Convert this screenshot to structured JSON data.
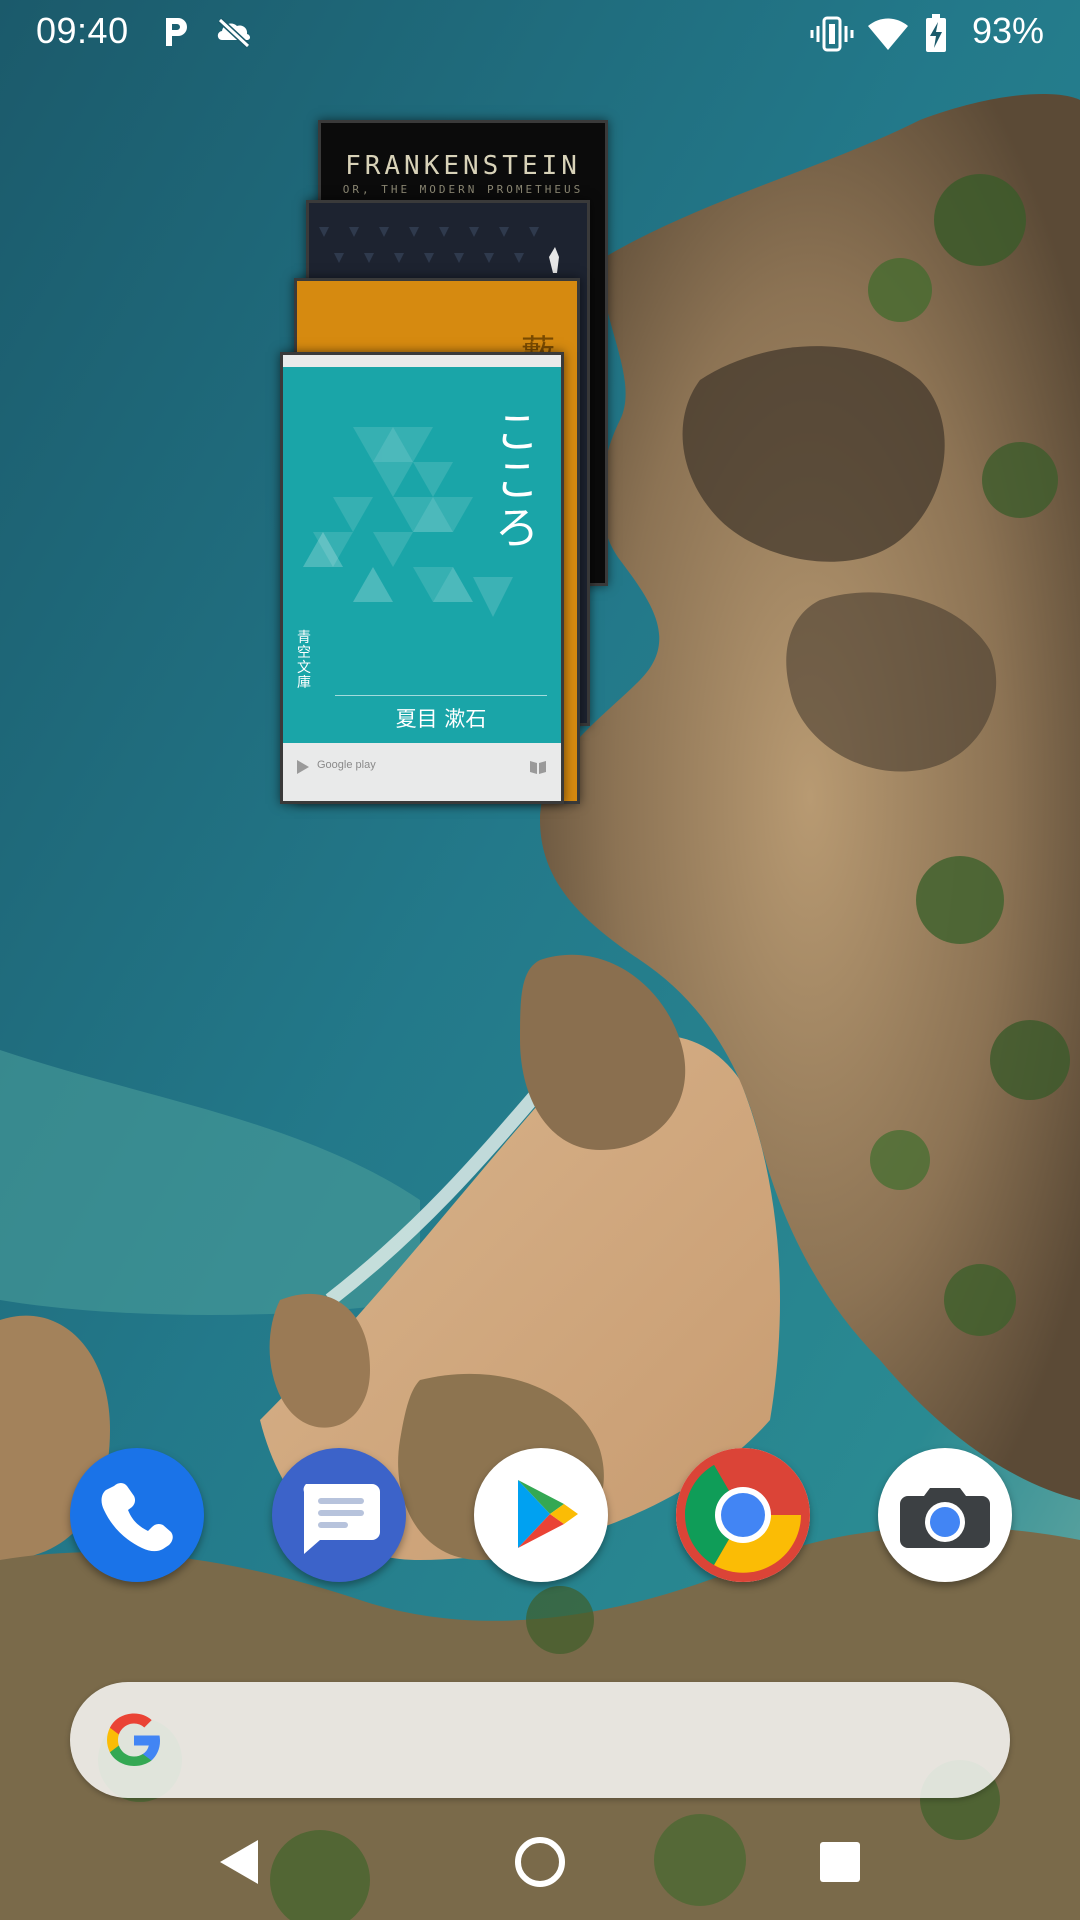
{
  "status_bar": {
    "time": "09:40",
    "battery": "93%",
    "left_icons": [
      "parking-p-icon",
      "cloud-off-icon"
    ],
    "right_icons": [
      "vibrate-icon",
      "wifi-icon",
      "battery-charging-icon"
    ]
  },
  "widget": {
    "books": [
      {
        "title": "FRANKENSTEIN",
        "subtitle": "OR, THE MODERN PROMETHEUS",
        "cover_color": "#0b0b0b"
      },
      {
        "title": "",
        "cover_color": "#1d2330"
      },
      {
        "title": "藪",
        "cover_color": "#d68a10"
      },
      {
        "title": "こころ",
        "series": "青空文庫",
        "author": "夏目 漱石",
        "brand": "Google play",
        "cover_color": "#1aa5a8"
      }
    ]
  },
  "dock": {
    "apps": [
      {
        "name": "Phone",
        "icon": "phone-icon",
        "color": "#1a73e8"
      },
      {
        "name": "Messages",
        "icon": "messages-icon",
        "color": "#3c63c9"
      },
      {
        "name": "Play Store",
        "icon": "play-store-icon",
        "color": "#ffffff"
      },
      {
        "name": "Chrome",
        "icon": "chrome-icon",
        "color": "#ffffff"
      },
      {
        "name": "Camera",
        "icon": "camera-icon",
        "color": "#ffffff"
      }
    ]
  },
  "search": {
    "icon": "google-g-icon"
  },
  "nav": {
    "buttons": [
      "back-icon",
      "home-icon",
      "recents-icon"
    ]
  }
}
